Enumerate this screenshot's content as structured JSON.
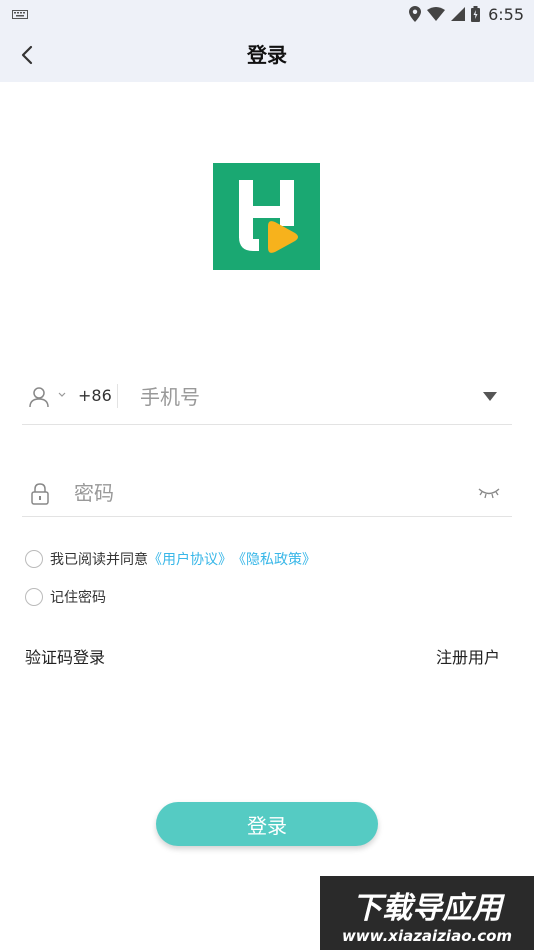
{
  "status_bar": {
    "time": "6:55",
    "icons": [
      "keyboard-icon",
      "location-icon",
      "wifi-icon",
      "signal-icon",
      "battery-icon"
    ]
  },
  "app_bar": {
    "title": "登录",
    "back_icon": "chevron-left-icon"
  },
  "logo": {
    "icon": "app-logo",
    "bg_color": "#1aa872",
    "accent_color": "#f7b21c"
  },
  "phone_field": {
    "icon": "person-icon",
    "country_code": "+86",
    "placeholder": "手机号",
    "value": ""
  },
  "password_field": {
    "icon": "lock-icon",
    "placeholder": "密码",
    "value": "",
    "toggle_icon": "eye-closed-icon"
  },
  "agreement": {
    "prefix": "我已阅读并同意",
    "user_agreement": "《用户协议》",
    "privacy_policy": "《隐私政策》",
    "checked": false
  },
  "remember": {
    "label": "记住密码",
    "checked": false
  },
  "links": {
    "sms_login": "验证码登录",
    "register": "注册用户"
  },
  "login_button": {
    "label": "登录",
    "color": "#55cbc3"
  },
  "watermark": {
    "line1": "下载导应用",
    "line2": "www.xiazaiziao.com"
  }
}
